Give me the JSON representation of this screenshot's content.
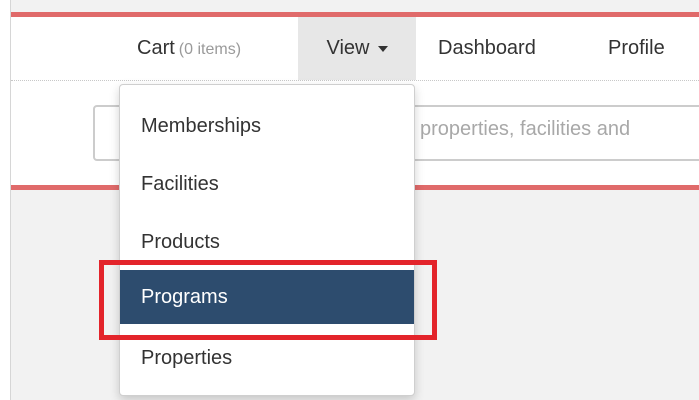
{
  "navbar": {
    "cart_label": "Cart",
    "cart_count": "(0 items)",
    "view_label": "View",
    "dashboard_label": "Dashboard",
    "profile_label": "Profile"
  },
  "search": {
    "placeholder": "properties, facilities and"
  },
  "dropdown": {
    "items": [
      {
        "label": "Memberships"
      },
      {
        "label": "Facilities"
      },
      {
        "label": "Products"
      },
      {
        "label": "Programs",
        "selected": true
      },
      {
        "label": "Properties"
      }
    ]
  },
  "colors": {
    "accent_red": "#e06a6a",
    "selected_bg": "#2d4c6e",
    "highlight_outline": "#e3242b"
  }
}
